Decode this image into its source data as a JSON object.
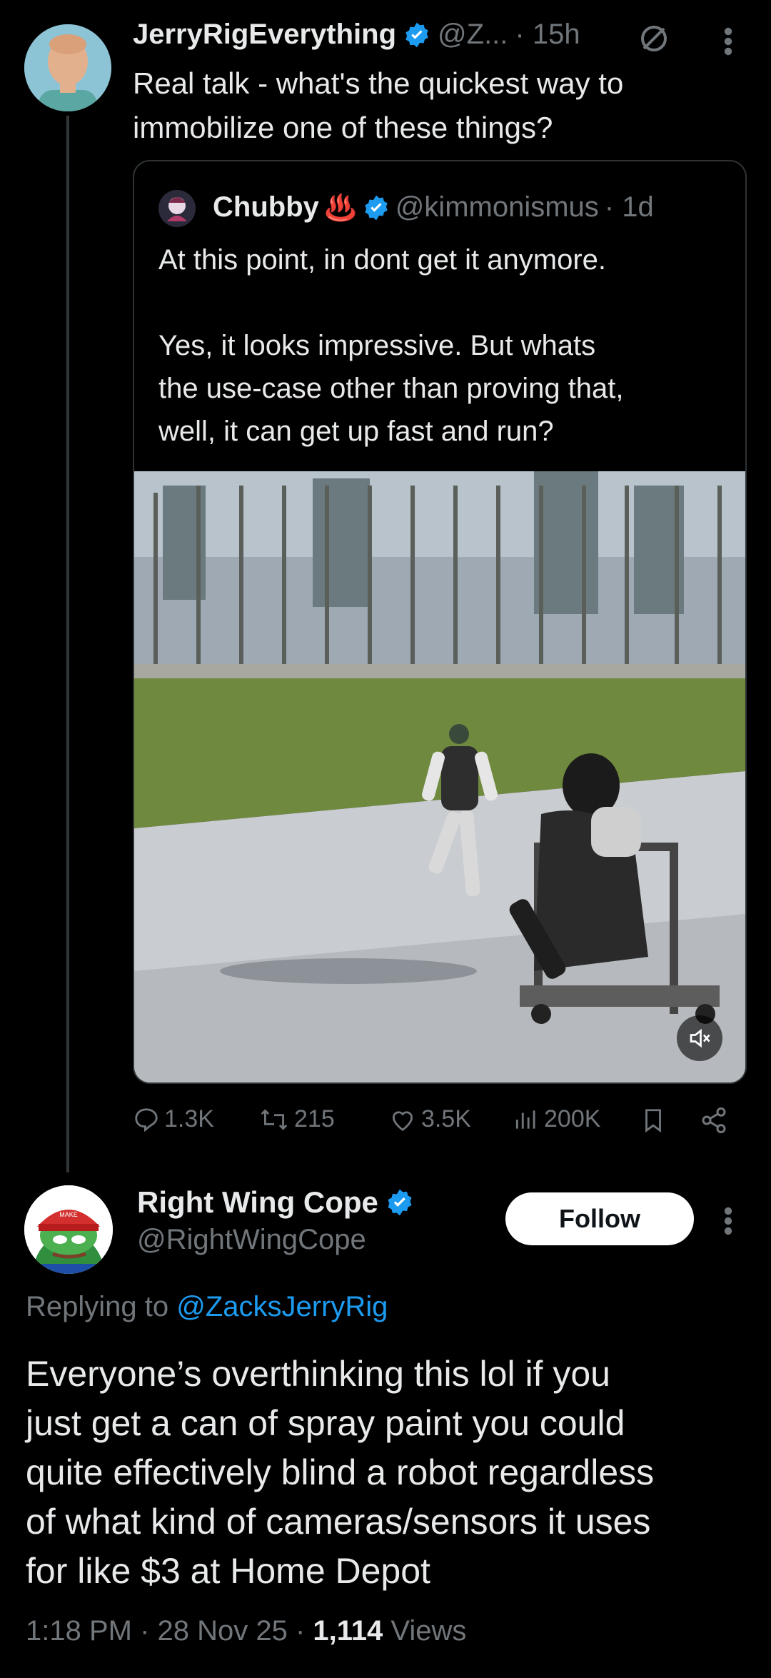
{
  "parent_tweet": {
    "author_name": "JerryRigEverything",
    "handle": "@Z...",
    "time": "· 15h",
    "text_line1": "Real talk - what's the quickest way to",
    "text_line2": "immobilize one of these things?"
  },
  "quoted_tweet": {
    "author_name": "Chubby",
    "emoji": "♨️",
    "handle": "@kimmonismus",
    "time": "· 1d",
    "line1": "At this point, in dont get it anymore.",
    "line2": "Yes, it looks impressive. But whats",
    "line3": "the use-case other than proving that,",
    "line4": "well, it can get up fast and run?"
  },
  "actions": {
    "replies": "1.3K",
    "reposts": "215",
    "likes": "3.5K",
    "views": "200K"
  },
  "reply": {
    "author_name": "Right Wing Cope",
    "handle": "@RightWingCope",
    "follow_label": "Follow",
    "replying_prefix": "Replying to ",
    "replying_to": "@ZacksJerryRig",
    "body_line1": "Everyone’s overthinking this lol if you",
    "body_line2": "just get a can of spray paint you could",
    "body_line3": "quite effectively blind a robot regardless",
    "body_line4": "of what kind of cameras/sensors it uses",
    "body_line5": "for like $3 at Home Depot",
    "time": "1:18 PM · 28 Nov 25 · ",
    "views_count": "1,114",
    "views_label": " Views"
  },
  "colors": {
    "accent": "#1d9bf0",
    "background": "#000000",
    "muted": "#71767b"
  }
}
